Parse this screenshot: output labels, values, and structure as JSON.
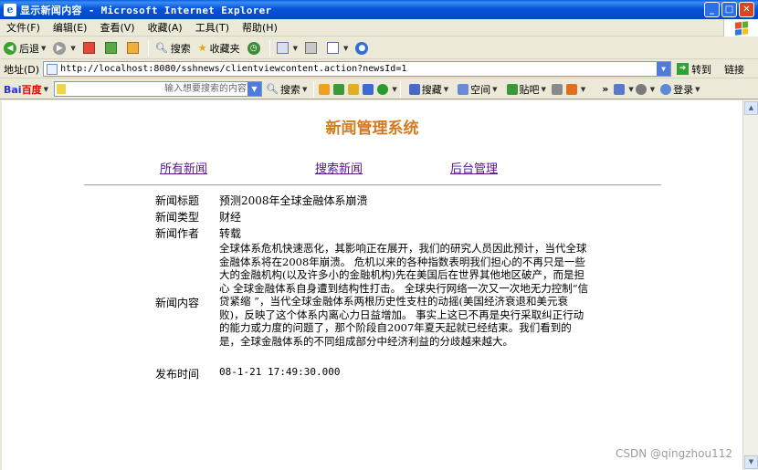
{
  "window": {
    "title": "显示新闻内容 - Microsoft Internet Explorer",
    "icon": "ie-page-icon",
    "buttons": [
      "_",
      "□",
      "✕"
    ]
  },
  "menu": [
    "文件(F)",
    "编辑(E)",
    "查看(V)",
    "收藏(A)",
    "工具(T)",
    "帮助(H)"
  ],
  "toolbar": {
    "back": "后退",
    "search": "搜索",
    "favorites": "收藏夹"
  },
  "address": {
    "label": "地址(D)",
    "url": "http://localhost:8080/sshnews/clientviewcontent.action?newsId=1",
    "go": "转到",
    "links": "链接"
  },
  "baidu": {
    "logo_a": "Bai",
    "logo_b": "百度",
    "placeholder": "输入想要搜索的内容",
    "search": "搜索",
    "items": [
      "搜藏",
      "空间",
      "贴吧"
    ],
    "login": "登录"
  },
  "page": {
    "title": "新闻管理系统",
    "nav": [
      "所有新闻",
      "搜索新闻",
      "后台管理"
    ],
    "fields": {
      "title_label": "新闻标题",
      "title_value": "预测2008年全球金融体系崩溃",
      "type_label": "新闻类型",
      "type_value": "财经",
      "author_label": "新闻作者",
      "author_value": "转载",
      "content_label": "新闻内容",
      "content_value": "全球体系危机快速恶化，其影响正在展开，我们的研究人员因此预计，当代全球金融体系将在2008年崩溃。 危机以来的各种指数表明我们担心的不再只是一些大的金融机构(以及许多小的金融机构)先在美国后在世界其他地区破产，而是担心 全球金融体系自身遭到结构性打击。 全球央行网络一次又一次地无力控制“信贷紧缩 ”，当代全球金融体系两根历史性支柱的动摇(美国经济衰退和美元衰败)，反映了这个体系内离心力日益增加。 事实上这已不再是央行采取纠正行动的能力或力度的问题了，那个阶段自2007年夏天起就已经结束。我们看到的是，全球金融体系的不同组成部分中经济利益的分歧越来越大。",
      "time_label": "发布时间",
      "time_value": "08-1-21 17:49:30.000"
    }
  },
  "watermark": "CSDN @qingzhou112"
}
